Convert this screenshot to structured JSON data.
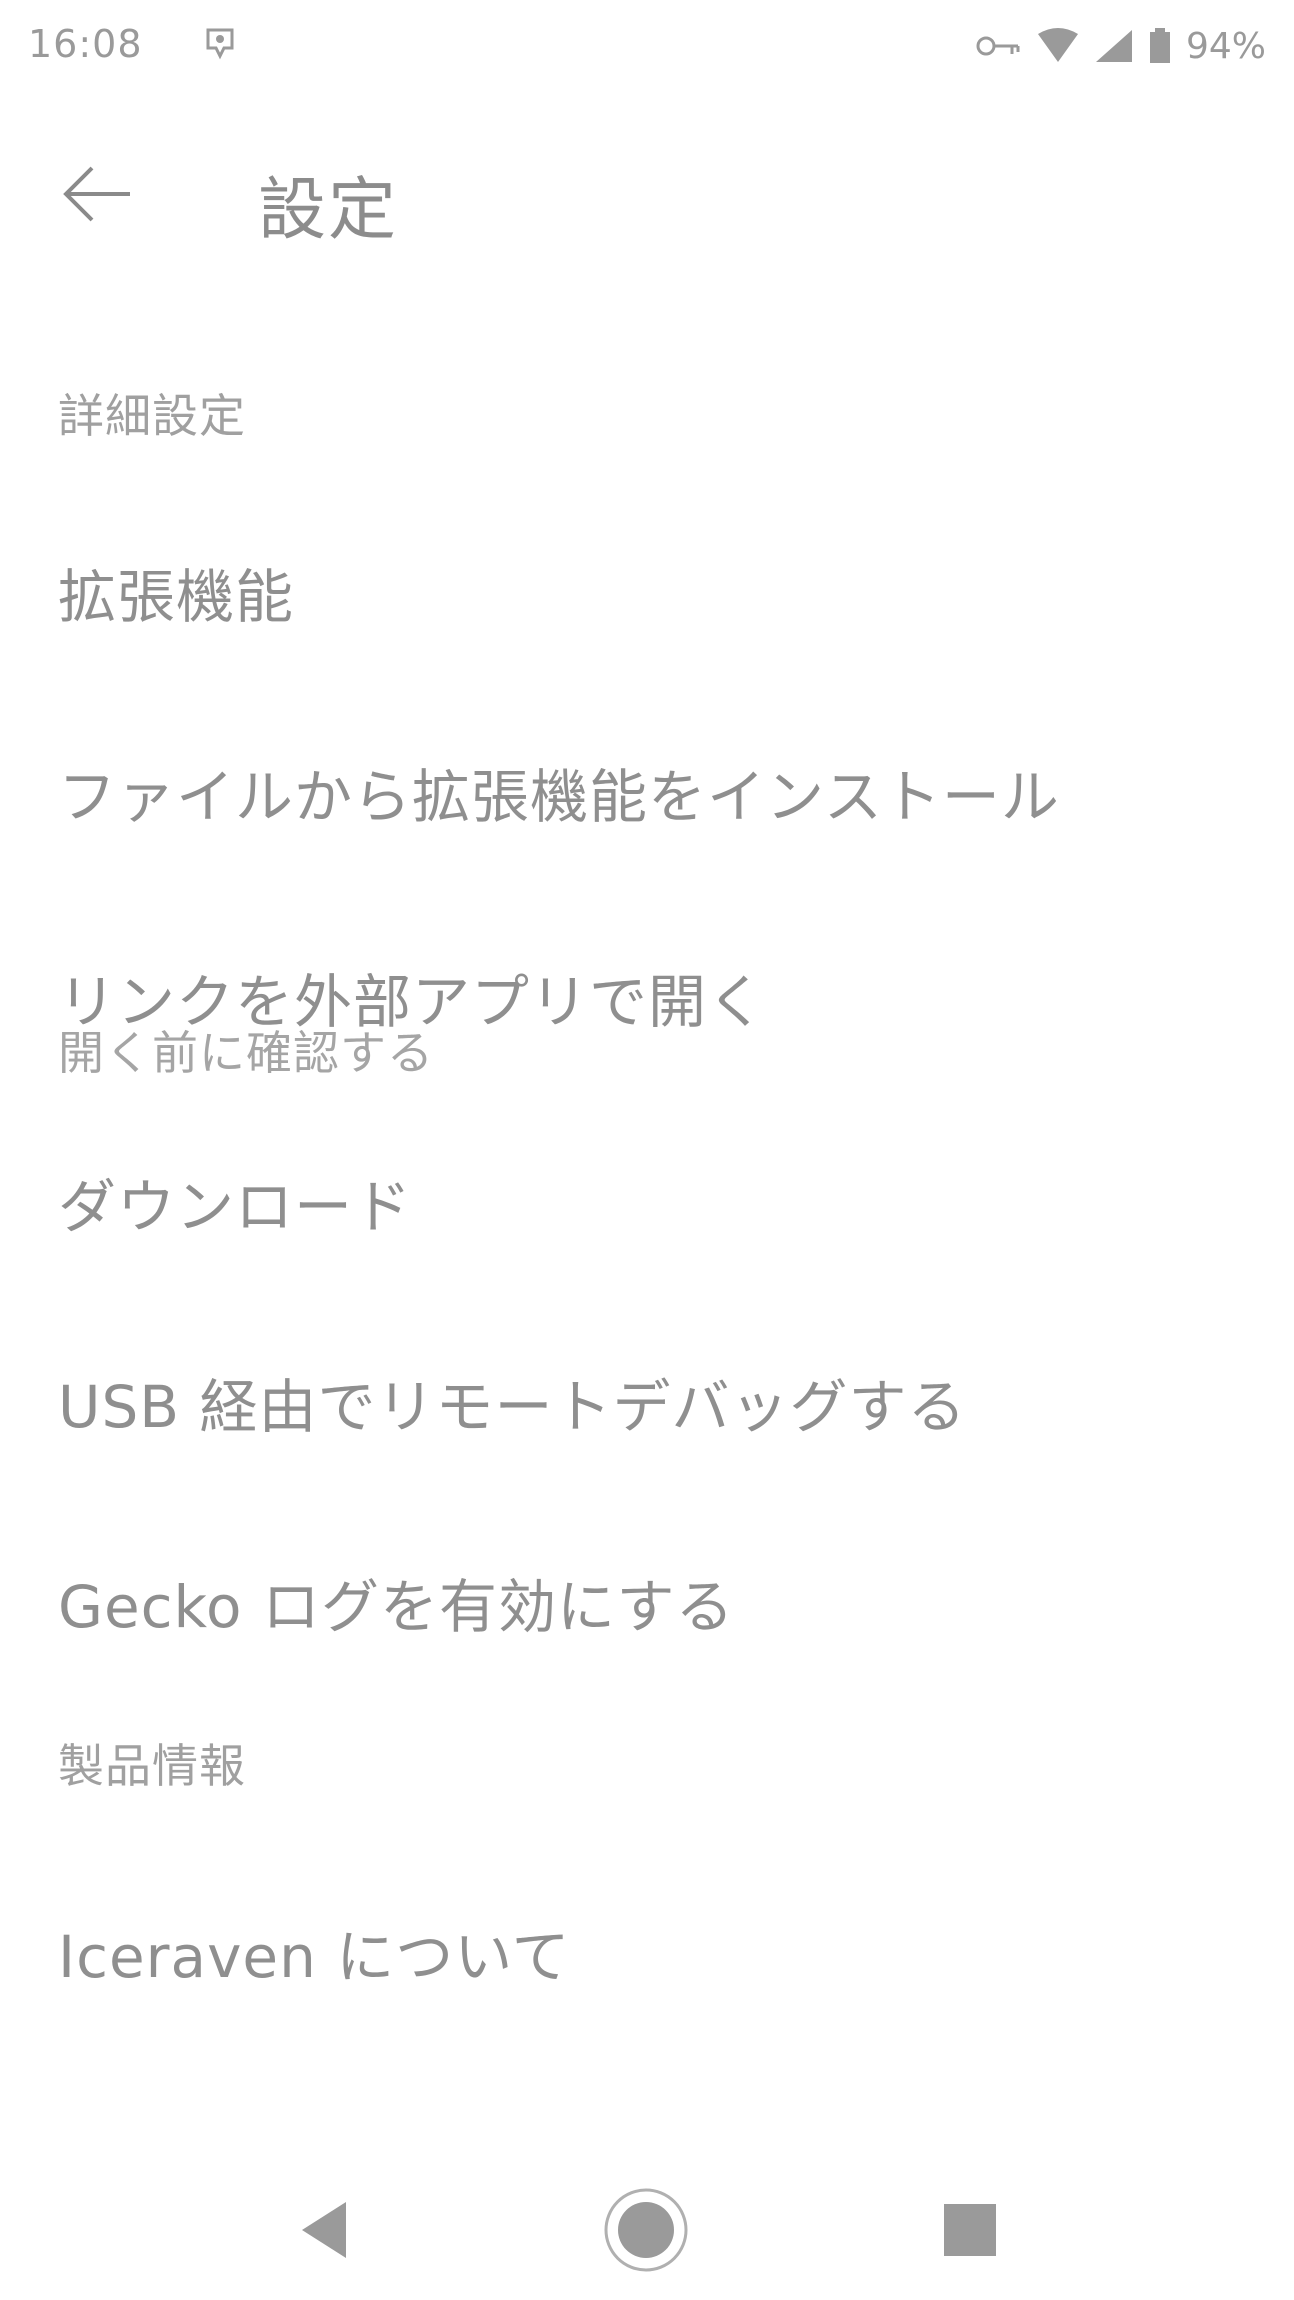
{
  "status_bar": {
    "time": "16:08",
    "battery": "94%",
    "icons": [
      "notification-icon",
      "key-icon",
      "wifi-icon",
      "signal-icon",
      "battery-icon"
    ]
  },
  "app_bar": {
    "back_icon": "arrow-left-icon",
    "title": "設定"
  },
  "sections": [
    {
      "header": "詳細設定",
      "items": [
        {
          "title": "拡張機能",
          "summary": ""
        },
        {
          "title": "ファイルから拡張機能をインストール",
          "summary": ""
        },
        {
          "title": "リンクを外部アプリで開く",
          "summary": "開く前に確認する"
        },
        {
          "title": "ダウンロード",
          "summary": ""
        },
        {
          "title": "USB 経由でリモートデバッグする",
          "summary": ""
        },
        {
          "title": "Gecko ログを有効にする",
          "summary": ""
        }
      ]
    },
    {
      "header": "製品情報",
      "items": [
        {
          "title": "Iceraven について",
          "summary": ""
        }
      ]
    }
  ],
  "nav_bar": {
    "icons": [
      "back-triangle-icon",
      "home-circle-icon",
      "recents-square-icon"
    ]
  },
  "colors": {
    "text": "#8f8f8f",
    "secondary_text": "#a5a5a5",
    "background": "#ffffff"
  }
}
